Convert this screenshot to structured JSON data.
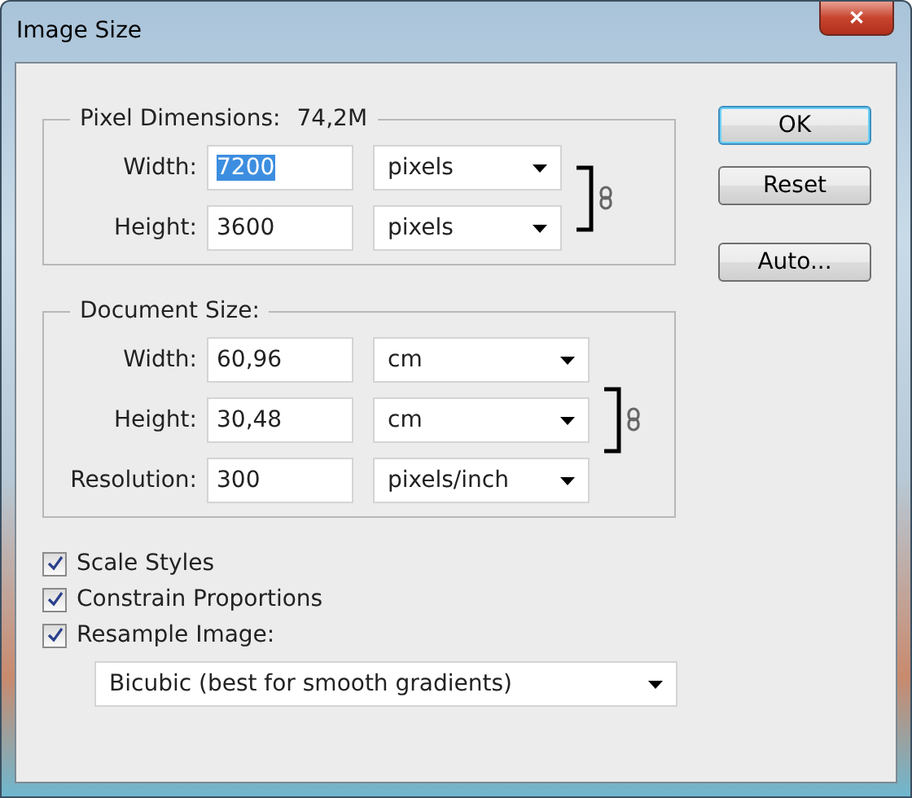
{
  "window": {
    "title": "Image Size",
    "close_label": "✕"
  },
  "pixel_dimensions": {
    "title": "Pixel Dimensions:",
    "value": "74,2M",
    "linked": true,
    "rows": [
      {
        "label": "Width:",
        "value": "7200",
        "highlighted": true,
        "unit": "pixels"
      },
      {
        "label": "Height:",
        "value": "3600",
        "highlighted": false,
        "unit": "pixels"
      }
    ]
  },
  "document_size": {
    "title": "Document Size:",
    "linked": true,
    "rows": [
      {
        "label": "Width:",
        "value": "60,96",
        "highlighted": false,
        "unit": "cm"
      },
      {
        "label": "Height:",
        "value": "30,48",
        "highlighted": false,
        "unit": "cm"
      },
      {
        "label": "Resolution:",
        "value": "300",
        "highlighted": false,
        "unit": "pixels/inch"
      }
    ]
  },
  "buttons": [
    {
      "label": "OK",
      "default": true
    },
    {
      "label": "Reset",
      "default": false
    },
    {
      "label": "Auto...",
      "default": false
    }
  ],
  "options": [
    {
      "label": "Scale Styles",
      "checked": true
    },
    {
      "label": "Constrain Proportions",
      "checked": true
    },
    {
      "label": "Resample Image:",
      "checked": true
    }
  ],
  "resample_method": "Bicubic (best for smooth gradients)"
}
